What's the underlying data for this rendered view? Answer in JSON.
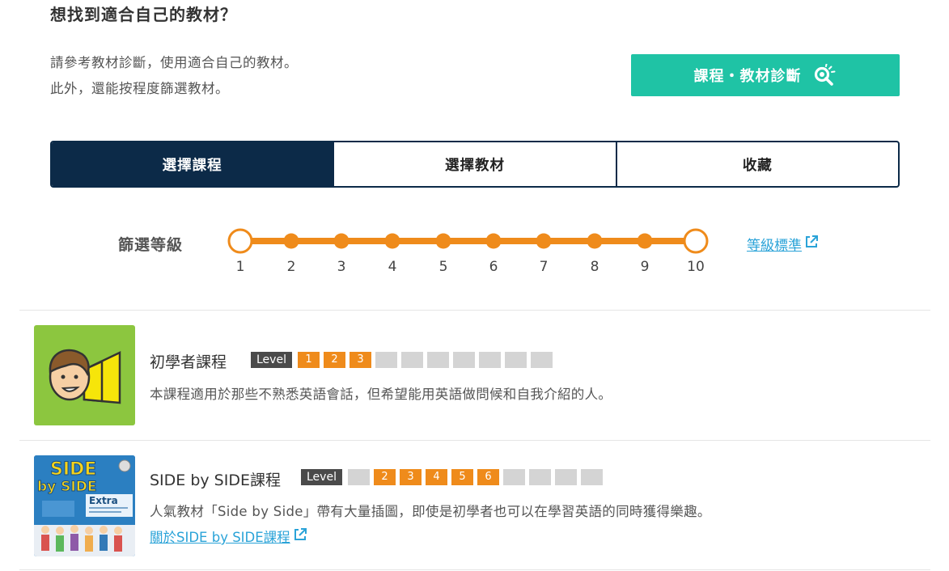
{
  "header": {
    "title": "想找到適合自己的教材？",
    "intro_line1": "請參考教材診斷，使用適合自己的教材。",
    "intro_line2": "此外，還能按程度篩選教材。",
    "diagnosis_button": "課程・教材診斷",
    "diagnosis_icon": "search-icon"
  },
  "tabs": [
    {
      "label": "選擇課程",
      "active": true
    },
    {
      "label": "選擇教材",
      "active": false
    },
    {
      "label": "收藏",
      "active": false
    }
  ],
  "filter": {
    "label": "篩選等級",
    "min": 1,
    "max": 10,
    "ticks": [
      "1",
      "2",
      "3",
      "4",
      "5",
      "6",
      "7",
      "8",
      "9",
      "10"
    ],
    "selected_range": [
      1,
      10
    ],
    "level_standard_link": "等級標準",
    "accent_color": "#ef8b1b"
  },
  "courses": [
    {
      "name": "初學者課程",
      "level_tag": "Level",
      "levels": [
        "1",
        "2",
        "3",
        "",
        "",
        "",
        "",
        "",
        "",
        ""
      ],
      "active_levels": [
        1,
        2,
        3
      ],
      "description": "本課程適用於那些不熟悉英語會話，但希望能用英語做問候和自我介紹的人。",
      "thumbnail_icon": "beginner-mark-icon"
    },
    {
      "name": "SIDE by SIDE課程",
      "level_tag": "Level",
      "levels": [
        "",
        "2",
        "3",
        "4",
        "5",
        "6",
        "",
        "",
        "",
        ""
      ],
      "active_levels": [
        2,
        3,
        4,
        5,
        6
      ],
      "description": "人氣教材「Side by Side」帶有大量插圖，即使是初學者也可以在學習英語的同時獲得樂趣。",
      "link": "關於SIDE by SIDE課程",
      "thumbnail_title_1": "SIDE",
      "thumbnail_title_2": "by SIDE",
      "thumbnail_title_3": "Extra"
    }
  ]
}
